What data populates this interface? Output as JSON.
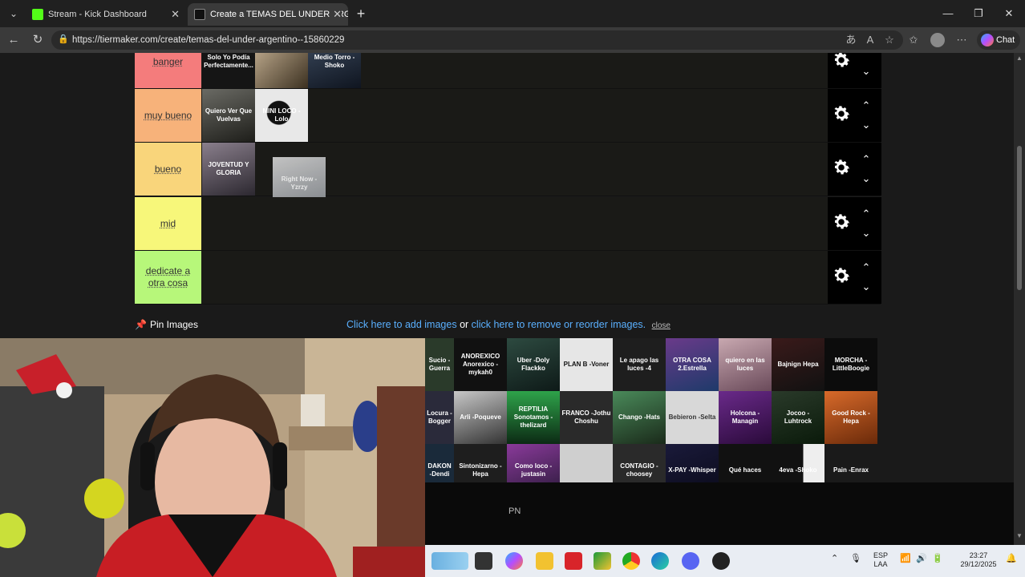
{
  "browser": {
    "tabs": [
      {
        "label": "Stream - Kick Dashboard",
        "active": false
      },
      {
        "label": "Create a TEMAS DEL UNDER ARGENTINO",
        "active": true
      }
    ],
    "url": "https://tiermaker.com/create/temas-del-under-argentino--15860229",
    "chat_label": "Chat"
  },
  "tiers": [
    {
      "label": "banger",
      "color": "#f47c7c",
      "items": [
        "Solo Yo Podía Perfectamente...",
        "",
        "Medio Torro -Shoko"
      ]
    },
    {
      "label": "muy bueno",
      "color": "#f7b27a",
      "items": [
        "Quiero Ver Que Vuelvas",
        "MINI LOCO -Lolo"
      ]
    },
    {
      "label": "bueno",
      "color": "#f9d57b",
      "items": [
        "JOVENTUD Y GLORIA",
        "Right Now -Yzrzy"
      ]
    },
    {
      "label": "mid",
      "color": "#f7f77a",
      "items": []
    },
    {
      "label": "dedicate a otra cosa",
      "color": "#b7f77a",
      "items": []
    }
  ],
  "pin": {
    "label": "Pin Images"
  },
  "instructions": {
    "add_link": "Click here to add images",
    "or_text": "or",
    "remove_link": "click here to remove or reorder images.",
    "close": "close"
  },
  "pool_items": [
    "Sucio -Guerra",
    "ANOREXICO Anorexico -mykah0",
    "Uber -Doly Flackko",
    "PLAN B -Voner",
    "Le apago las luces -4",
    "OTRA COSA 2.Estrella",
    "quiero en las luces",
    "Bajnign Hepa",
    "MORCHA -LittleBoogie",
    "Locura -Bogger",
    "Arli -Poqueve",
    "REPTILIA Sonotamos -thelizard",
    "FRANCO -Jothu Choshu",
    "Chango -Hats",
    "Bebieron -Selta",
    "Holcona -Managin",
    "Jocoo -Luhtrock",
    "Good Rock -Hepa",
    "DAKON -Dendi",
    "Sintonizarno -Hepa",
    "Como loco -justasin",
    "",
    "CONTAGIO -choosey",
    "X-PAY -Whisper",
    "Qué haces",
    "4eva -Shoko",
    "Pain -Enrax"
  ],
  "overlay_text": "PN",
  "taskbar": {
    "lang": "ESP",
    "region": "LAA",
    "time": "23:27",
    "date": "29/12/2025"
  }
}
